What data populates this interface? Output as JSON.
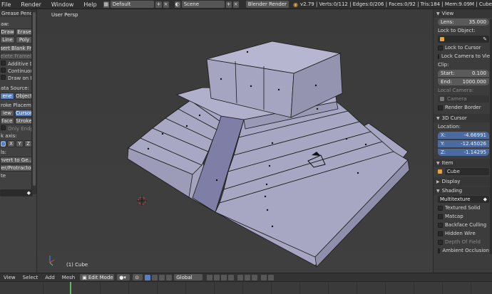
{
  "topbar": {
    "menus": [
      "File",
      "Render",
      "Window",
      "Help"
    ],
    "screen_layout": "Default",
    "scene": "Scene",
    "render_engine": "Blender Render",
    "stats": "v2.79 | Verts:0/112 | Edges:0/206 | Faces:0/92 | Tris:184 | Mem:9.09M | Cube"
  },
  "toolshelf": {
    "panel_title": "Grease Pencil",
    "draw_label": "aw:",
    "btn_draw": "Draw",
    "btn_erase": "Erase",
    "btn_line": "Line",
    "btn_poly": "Poly",
    "btn_insert_blank": "nsert Blank Fr...",
    "btn_delete_frames": "Delete Frame(s)",
    "btn_additive": "Additive Dra...",
    "btn_continuous": "Continuous ...",
    "btn_draw_on_back": "Draw on Back",
    "data_source_label": "ata Source:",
    "btn_scene": "ene",
    "btn_object": "Object",
    "stroke_placement_label": "roke Placement:",
    "btn_view": "iew",
    "btn_cursor": "Cursor",
    "btn_surface": "face",
    "btn_stroke": "Stroke",
    "only_endpoints": "Only Endpoi...",
    "axis_label": "k axis:",
    "axis_x": "X",
    "axis_y": "Y",
    "axis_z": "Z",
    "tools_label": "ls:",
    "btn_convert": "nvert to Ge...",
    "btn_ruler": "ler/Protractor",
    "bottom_label": "te"
  },
  "viewport": {
    "view_name": "User Persp",
    "object_label": "(1) Cube"
  },
  "properties": {
    "view_panel": "View",
    "lens_label": "Lens:",
    "lens_value": "35.000",
    "lock_to_object": "Lock to Object:",
    "lock_to_cursor": "Lock to Cursor",
    "lock_camera_to_view": "Lock Camera to View",
    "clip_label": "Clip:",
    "clip_start_label": "Start:",
    "clip_start_value": "0.100",
    "clip_end_label": "End:",
    "clip_end_value": "1000.000",
    "local_camera_label": "Local Camera:",
    "camera_value": "Camera",
    "render_border": "Render Border",
    "cursor_panel": "3D Cursor",
    "location_label": "Location:",
    "x_label": "X:",
    "x_value": "-4.66991",
    "y_label": "Y:",
    "y_value": "-12.45026",
    "z_label": "Z:",
    "z_value": "-1.14295",
    "item_panel": "Item",
    "item_name": "Cube",
    "display_panel": "Display",
    "shading_panel": "Shading",
    "shading_mode": "Multitexture",
    "textured_solid": "Textured Solid",
    "matcap": "Matcap",
    "backface_culling": "Backface Culling",
    "hidden_wire": "Hidden Wire",
    "depth_of_field": "Depth Of Field",
    "ambient_occlusion": "Ambient Occlusion"
  },
  "bottombar": {
    "view": "View",
    "select": "Select",
    "add": "Add",
    "mesh": "Mesh",
    "mode": "Edit Mode",
    "pivot": "Global"
  },
  "colors": {
    "accent": "#5680c2",
    "mesh_face": "#a6a6c4",
    "mesh_face_dark": "#8e8eac",
    "playhead": "#5fb85f",
    "object_icon": "#e8a33a"
  }
}
